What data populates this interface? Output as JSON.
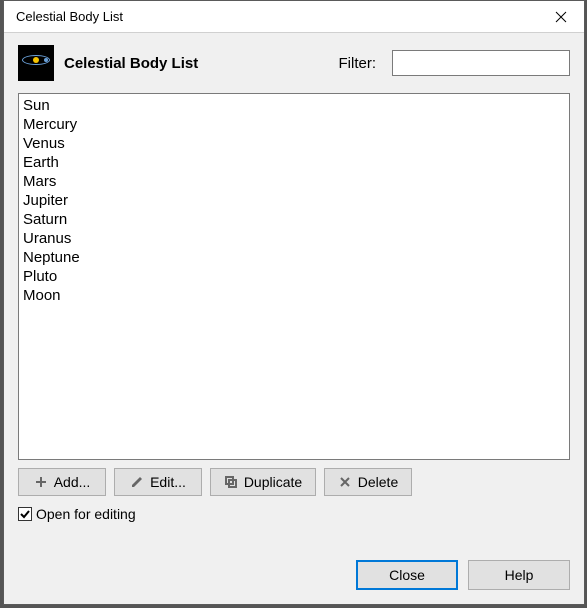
{
  "window": {
    "title": "Celestial Body List"
  },
  "header": {
    "title": "Celestial Body List",
    "filter_label": "Filter:",
    "filter_value": ""
  },
  "list": {
    "items": [
      "Sun",
      "Mercury",
      "Venus",
      "Earth",
      "Mars",
      "Jupiter",
      "Saturn",
      "Uranus",
      "Neptune",
      "Pluto",
      "Moon"
    ]
  },
  "toolbar": {
    "add_label": "Add...",
    "edit_label": "Edit...",
    "duplicate_label": "Duplicate",
    "delete_label": "Delete"
  },
  "checkbox": {
    "open_label": "Open for editing",
    "open_checked": true
  },
  "footer": {
    "close_label": "Close",
    "help_label": "Help"
  }
}
